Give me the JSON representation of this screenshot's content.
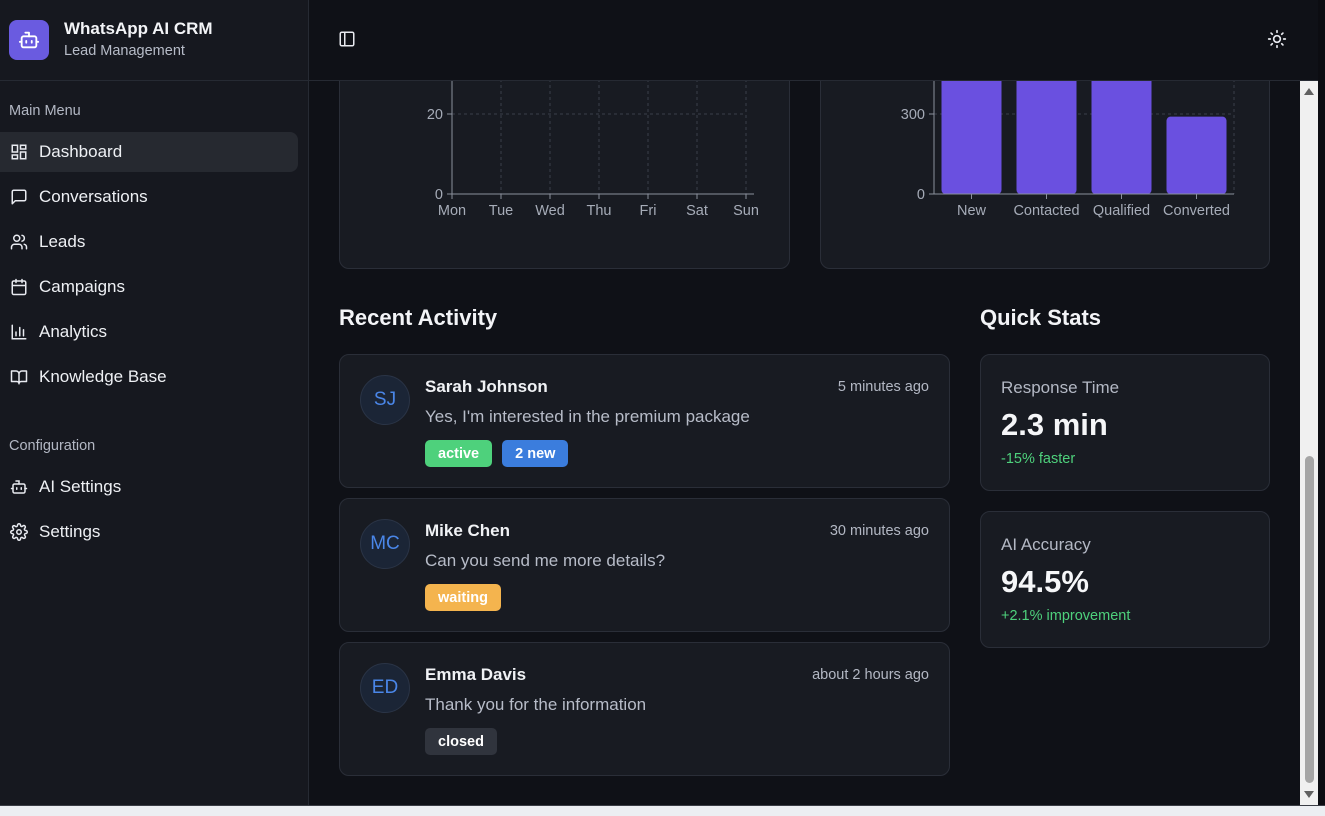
{
  "brand": {
    "title": "WhatsApp AI CRM",
    "subtitle": "Lead Management"
  },
  "sidebar": {
    "main_menu_label": "Main Menu",
    "main_items": [
      {
        "label": "Dashboard",
        "icon": "dashboard-icon",
        "active": true
      },
      {
        "label": "Conversations",
        "icon": "message-icon"
      },
      {
        "label": "Leads",
        "icon": "users-icon"
      },
      {
        "label": "Campaigns",
        "icon": "calendar-icon"
      },
      {
        "label": "Analytics",
        "icon": "bar-chart-icon"
      },
      {
        "label": "Knowledge Base",
        "icon": "book-icon"
      }
    ],
    "config_label": "Configuration",
    "config_items": [
      {
        "label": "AI Settings",
        "icon": "bot-icon"
      },
      {
        "label": "Settings",
        "icon": "gear-icon"
      }
    ]
  },
  "chart_data": [
    {
      "type": "line",
      "categories": [
        "Mon",
        "Tue",
        "Wed",
        "Thu",
        "Fri",
        "Sat",
        "Sun"
      ],
      "y_ticks": [
        "0",
        "20"
      ],
      "grid": true
    },
    {
      "type": "bar",
      "categories": [
        "New",
        "Contacted",
        "Qualified",
        "Converted"
      ],
      "values": [
        450,
        450,
        450,
        290
      ],
      "y_ticks": [
        "0",
        "300"
      ],
      "grid": true,
      "color": "#6a50e0"
    }
  ],
  "activity": {
    "title": "Recent Activity",
    "items": [
      {
        "initials": "SJ",
        "name": "Sarah Johnson",
        "time": "5 minutes ago",
        "message": "Yes, I'm interested in the premium package",
        "badges": [
          {
            "label": "active",
            "color": "#4ed17c"
          },
          {
            "label": "2 new",
            "color": "#3b7ddd"
          }
        ]
      },
      {
        "initials": "MC",
        "name": "Mike Chen",
        "time": "30 minutes ago",
        "message": "Can you send me more details?",
        "badges": [
          {
            "label": "waiting",
            "color": "#f4b44e"
          }
        ]
      },
      {
        "initials": "ED",
        "name": "Emma Davis",
        "time": "about 2 hours ago",
        "message": "Thank you for the information",
        "badges": [
          {
            "label": "closed",
            "color": "#30343d"
          }
        ]
      }
    ]
  },
  "quick_stats": {
    "title": "Quick Stats",
    "items": [
      {
        "label": "Response Time",
        "value": "2.3 min",
        "delta": "-15% faster"
      },
      {
        "label": "AI Accuracy",
        "value": "94.5%",
        "delta": "+2.1% improvement"
      }
    ]
  }
}
